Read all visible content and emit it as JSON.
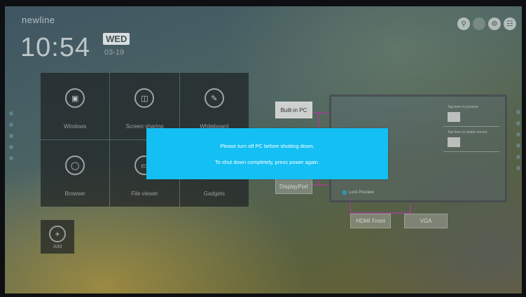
{
  "brand": "newline",
  "clock": {
    "time": "10:54",
    "day": "WED",
    "date": "03-19"
  },
  "top_icons": [
    "lock-icon",
    "circle-icon",
    "gear-icon",
    "exit-icon"
  ],
  "tiles": [
    {
      "label": "Windows",
      "icon": "windows-pc-icon"
    },
    {
      "label": "Screen sharing",
      "icon": "screen-share-icon"
    },
    {
      "label": "Whiteboard",
      "icon": "pen-icon"
    },
    {
      "label": "Browser",
      "icon": "globe-icon"
    },
    {
      "label": "File viewer",
      "icon": "folder-icon"
    },
    {
      "label": "Gadgets",
      "icon": "gadgets-icon"
    }
  ],
  "add_tile": {
    "label": "Add",
    "icon": "add-icon"
  },
  "sources": {
    "builtin_pc": "Built-in PC",
    "display_port": "DisplayPort",
    "hdmi_front": "HDMI Front",
    "vga": "VGA"
  },
  "preview": {
    "caption1": "Tap here to preview",
    "caption2": "Tap here to switch source",
    "lock_label": "Lock Preview"
  },
  "dialog": {
    "line1": "Please turn off PC before shutting down.",
    "line2": "To shut down completely, press power again."
  },
  "colors": {
    "dialog_bg": "#14bff3",
    "accent_wire": "#964690"
  }
}
